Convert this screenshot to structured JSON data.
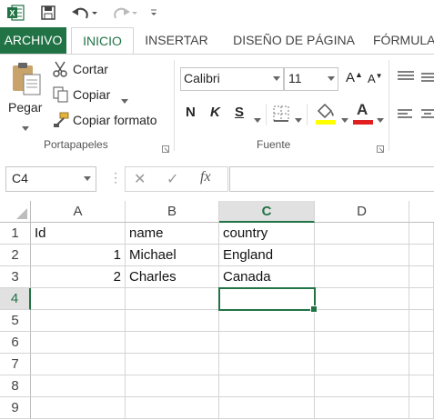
{
  "qat": {
    "icons": [
      "excel-logo-icon",
      "save-icon",
      "undo-icon",
      "redo-icon",
      "customize-qat-icon"
    ]
  },
  "tabs": [
    "ARCHIVO",
    "INICIO",
    "INSERTAR",
    "DISEÑO DE PÁGINA",
    "FÓRMULA"
  ],
  "active_tab": "INICIO",
  "ribbon": {
    "paste_label": "Pegar",
    "cut_label": "Cortar",
    "copy_label": "Copiar",
    "format_painter_label": "Copiar formato",
    "clipboard_group": "Portapapeles",
    "font_name": "Calibri",
    "font_size": "11",
    "grow_font": "A",
    "shrink_font": "A",
    "bold": "N",
    "italic": "K",
    "underline": "S",
    "font_color_letter": "A",
    "font_group": "Fuente"
  },
  "formula_bar": {
    "name_box": "C4",
    "fx": "fx",
    "value": ""
  },
  "grid": {
    "columns": [
      "A",
      "B",
      "C",
      "D"
    ],
    "selected_column": "C",
    "rows": [
      "1",
      "2",
      "3",
      "4",
      "5",
      "6",
      "7",
      "8",
      "9"
    ],
    "selected_row": "4",
    "cells": {
      "A1": "Id",
      "B1": "name",
      "C1": "country",
      "A2": "1",
      "B2": "Michael",
      "C2": "England",
      "A3": "2",
      "B3": "Charles",
      "C3": "Canada"
    }
  },
  "colors": {
    "accent": "#217346",
    "header_selected": "#e1e1e1",
    "gridline": "#d4d4d4"
  }
}
